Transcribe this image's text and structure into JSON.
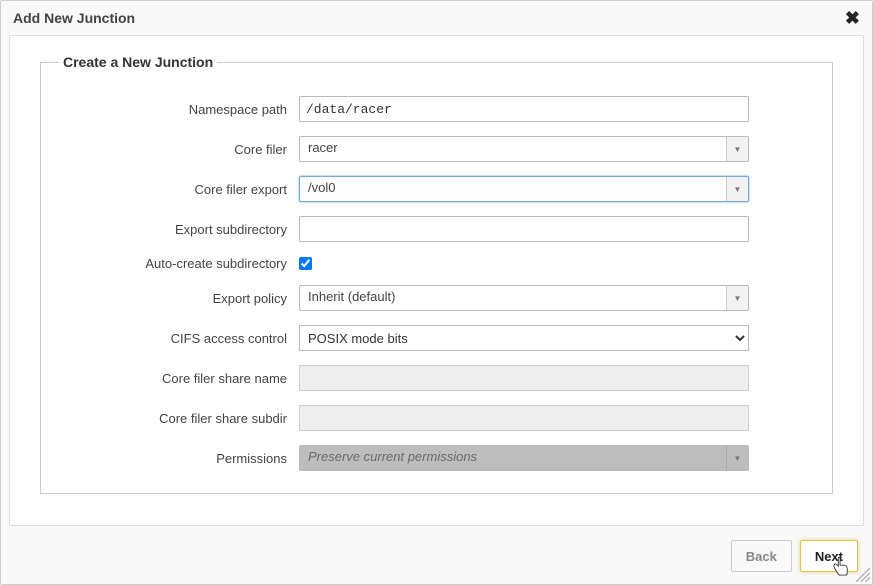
{
  "dialog": {
    "title": "Add New Junction",
    "group_title": "Create a New Junction"
  },
  "labels": {
    "namespace_path": "Namespace path",
    "core_filer": "Core filer",
    "core_filer_export": "Core filer export",
    "export_subdir": "Export subdirectory",
    "auto_create_subdir": "Auto-create subdirectory",
    "export_policy": "Export policy",
    "cifs_access_control": "CIFS access control",
    "core_filer_share_name": "Core filer share name",
    "core_filer_share_subdir": "Core filer share subdir",
    "permissions": "Permissions"
  },
  "values": {
    "namespace_path": "/data/racer",
    "core_filer": "racer",
    "core_filer_export": "/vol0",
    "export_subdir": "",
    "auto_create_subdir": true,
    "export_policy": "Inherit (default)",
    "cifs_access_control": "POSIX mode bits",
    "core_filer_share_name": "",
    "core_filer_share_subdir": "",
    "permissions": "Preserve current permissions"
  },
  "buttons": {
    "back": "Back",
    "next": "Next"
  }
}
